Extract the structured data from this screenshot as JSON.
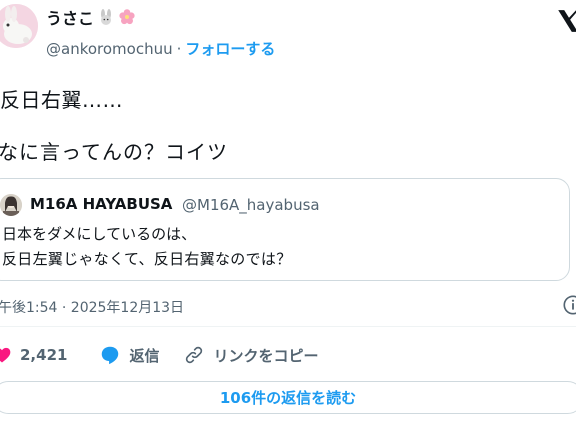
{
  "author": {
    "name": "うさこ",
    "emoji_icons": [
      "rabbit-icon",
      "cherry-blossom-icon"
    ],
    "handle": "@ankoromochuu",
    "separator": "·",
    "follow_label": "フォローする"
  },
  "post": {
    "line1": "反日右翼……",
    "line2": "なに言ってんの？コイツ"
  },
  "quoted": {
    "name": "M16A HAYABUSA",
    "handle": "@M16A_hayabusa",
    "line1": "日本をダメにしているのは、",
    "line2": "反日左翼じゃなくて、反日右翼なのでは？"
  },
  "timestamp": "午後1:54 · 2025年12月13日",
  "actions": {
    "likes": "2,421",
    "reply_label": "返信",
    "copy_link_label": "リンクをコピー"
  },
  "read_replies_label": "106件の返信を読む",
  "colors": {
    "accent": "#1d9bf0",
    "like": "#f91880",
    "text": "#0f1419",
    "muted": "#536471",
    "border": "#cfd9de"
  }
}
